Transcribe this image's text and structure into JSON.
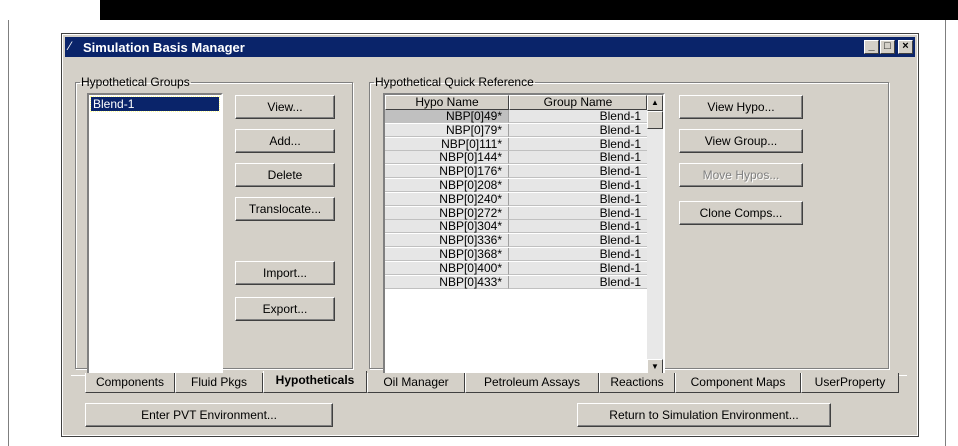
{
  "window": {
    "title": "Simulation Basis Manager"
  },
  "hypo_groups": {
    "legend": "Hypothetical Groups",
    "items": [
      "Blend-1"
    ],
    "buttons": {
      "view": "View...",
      "add": "Add...",
      "delete": "Delete",
      "translocate": "Translocate...",
      "import": "Import...",
      "export": "Export..."
    }
  },
  "quick_ref": {
    "legend": "Hypothetical Quick Reference",
    "columns": [
      "Hypo Name",
      "Group Name"
    ],
    "rows": [
      [
        "NBP[0]49*",
        "Blend-1"
      ],
      [
        "NBP[0]79*",
        "Blend-1"
      ],
      [
        "NBP[0]111*",
        "Blend-1"
      ],
      [
        "NBP[0]144*",
        "Blend-1"
      ],
      [
        "NBP[0]176*",
        "Blend-1"
      ],
      [
        "NBP[0]208*",
        "Blend-1"
      ],
      [
        "NBP[0]240*",
        "Blend-1"
      ],
      [
        "NBP[0]272*",
        "Blend-1"
      ],
      [
        "NBP[0]304*",
        "Blend-1"
      ],
      [
        "NBP[0]336*",
        "Blend-1"
      ],
      [
        "NBP[0]368*",
        "Blend-1"
      ],
      [
        "NBP[0]400*",
        "Blend-1"
      ],
      [
        "NBP[0]433*",
        "Blend-1"
      ]
    ],
    "buttons": {
      "view_hypo": "View Hypo...",
      "view_group": "View Group...",
      "move_hypos": "Move Hypos...",
      "clone_comps": "Clone Comps..."
    }
  },
  "tabs": [
    "Components",
    "Fluid Pkgs",
    "Hypotheticals",
    "Oil Manager",
    "Petroleum Assays",
    "Reactions",
    "Component Maps",
    "UserProperty"
  ],
  "active_tab": "Hypotheticals",
  "footer": {
    "enter_pvt": "Enter PVT Environment...",
    "return_sim": "Return to Simulation Environment..."
  },
  "colors": {
    "titlebar": "#0a246a",
    "face": "#d4d0c8",
    "selection": "#0a246a"
  }
}
